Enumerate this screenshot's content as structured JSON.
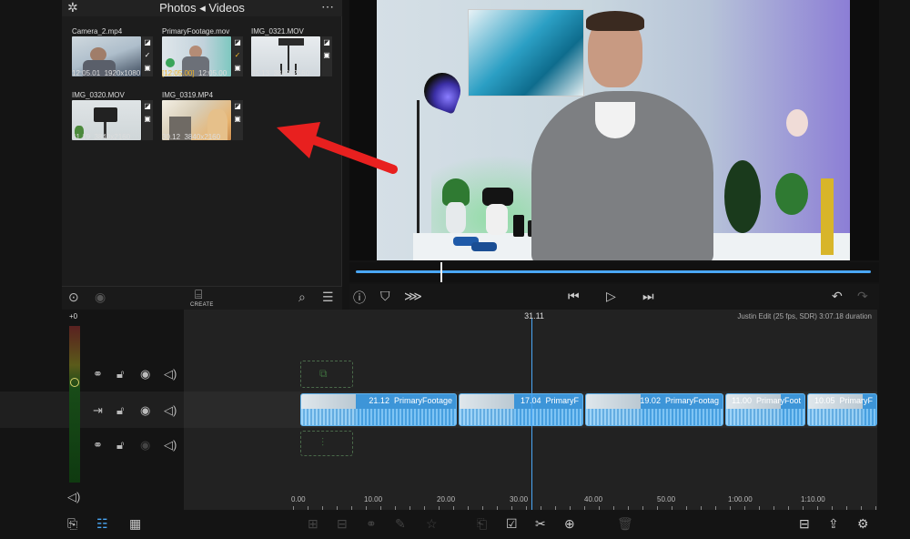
{
  "browser": {
    "title": "Photos ◂ Videos",
    "items": [
      {
        "name": "Camera_2.mp4",
        "duration": "12:05.01",
        "resolution": "1920x1080",
        "in_point": ""
      },
      {
        "name": "PrimaryFootage.mov",
        "duration": "12:05.00",
        "resolution": "",
        "in_point": "[12:05.00]"
      },
      {
        "name": "IMG_0321.MOV",
        "duration": "35.13",
        "resolution": "3840x2160",
        "in_point": ""
      },
      {
        "name": "IMG_0320.MOV",
        "duration": "41.19",
        "resolution": "3840x2160",
        "in_point": ""
      },
      {
        "name": "IMG_0319.MP4",
        "duration": "30.12",
        "resolution": "3840x2160",
        "in_point": ""
      }
    ],
    "toolbar": {
      "create_label": "CREATE"
    }
  },
  "timeline": {
    "playhead_time": "31.11",
    "project_info": "Justin Edit (25 fps, SDR) 3:07.18 duration",
    "clips": [
      {
        "duration": "21.12",
        "name": "PrimaryFootage"
      },
      {
        "duration": "17.04",
        "name": "PrimaryF"
      },
      {
        "duration": "19.02",
        "name": "PrimaryFootag"
      },
      {
        "duration": "11.00",
        "name": "PrimaryFoot"
      },
      {
        "duration": "10.05",
        "name": "PrimaryF"
      }
    ],
    "ruler": [
      "0.00",
      "10.00",
      "20.00",
      "30.00",
      "40.00",
      "50.00",
      "1:00.00",
      "1:10.00"
    ]
  },
  "meter": {
    "label": "+0"
  },
  "colors": {
    "accent": "#4aa7f5",
    "clip": "#3d95d8",
    "highlight": "#f1b526",
    "arrow": "#e8201f"
  }
}
